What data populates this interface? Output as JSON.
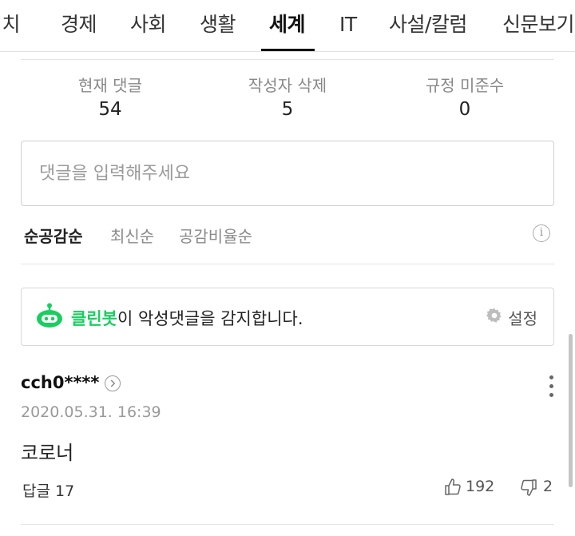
{
  "nav_tabs": [
    "정치",
    "경제",
    "사회",
    "생활",
    "세계",
    "IT",
    "사설/칼럼",
    "신문보기"
  ],
  "active_tab": "세계",
  "stats": {
    "current": {
      "label": "현재 댓글",
      "value": "54"
    },
    "deleted_by_author": {
      "label": "작성자 삭제",
      "value": "5"
    },
    "policy_violation": {
      "label": "규정 미준수",
      "value": "0"
    }
  },
  "comment_input": {
    "placeholder": "댓글을 입력해주세요"
  },
  "sort": {
    "options": [
      "순공감순",
      "최신순",
      "공감비율순"
    ],
    "selected": "순공감순"
  },
  "cleanbot": {
    "name": "클린봇",
    "message": "이 악성댓글을 감지합니다.",
    "settings_label": "설정"
  },
  "comment": {
    "author": "cch0****",
    "date": "2020.05.31. 16:39",
    "text": "코로너",
    "reply_label": "답글 17",
    "likes": "192",
    "dislikes": "2"
  },
  "colors": {
    "accent_green": "#19ce60",
    "text_primary": "#222222",
    "text_secondary": "#888888"
  },
  "icons": [
    "info-icon",
    "robot-icon",
    "gear-icon",
    "chevron-right-icon",
    "more-vertical-icon",
    "thumbs-up-icon",
    "thumbs-down-icon"
  ]
}
